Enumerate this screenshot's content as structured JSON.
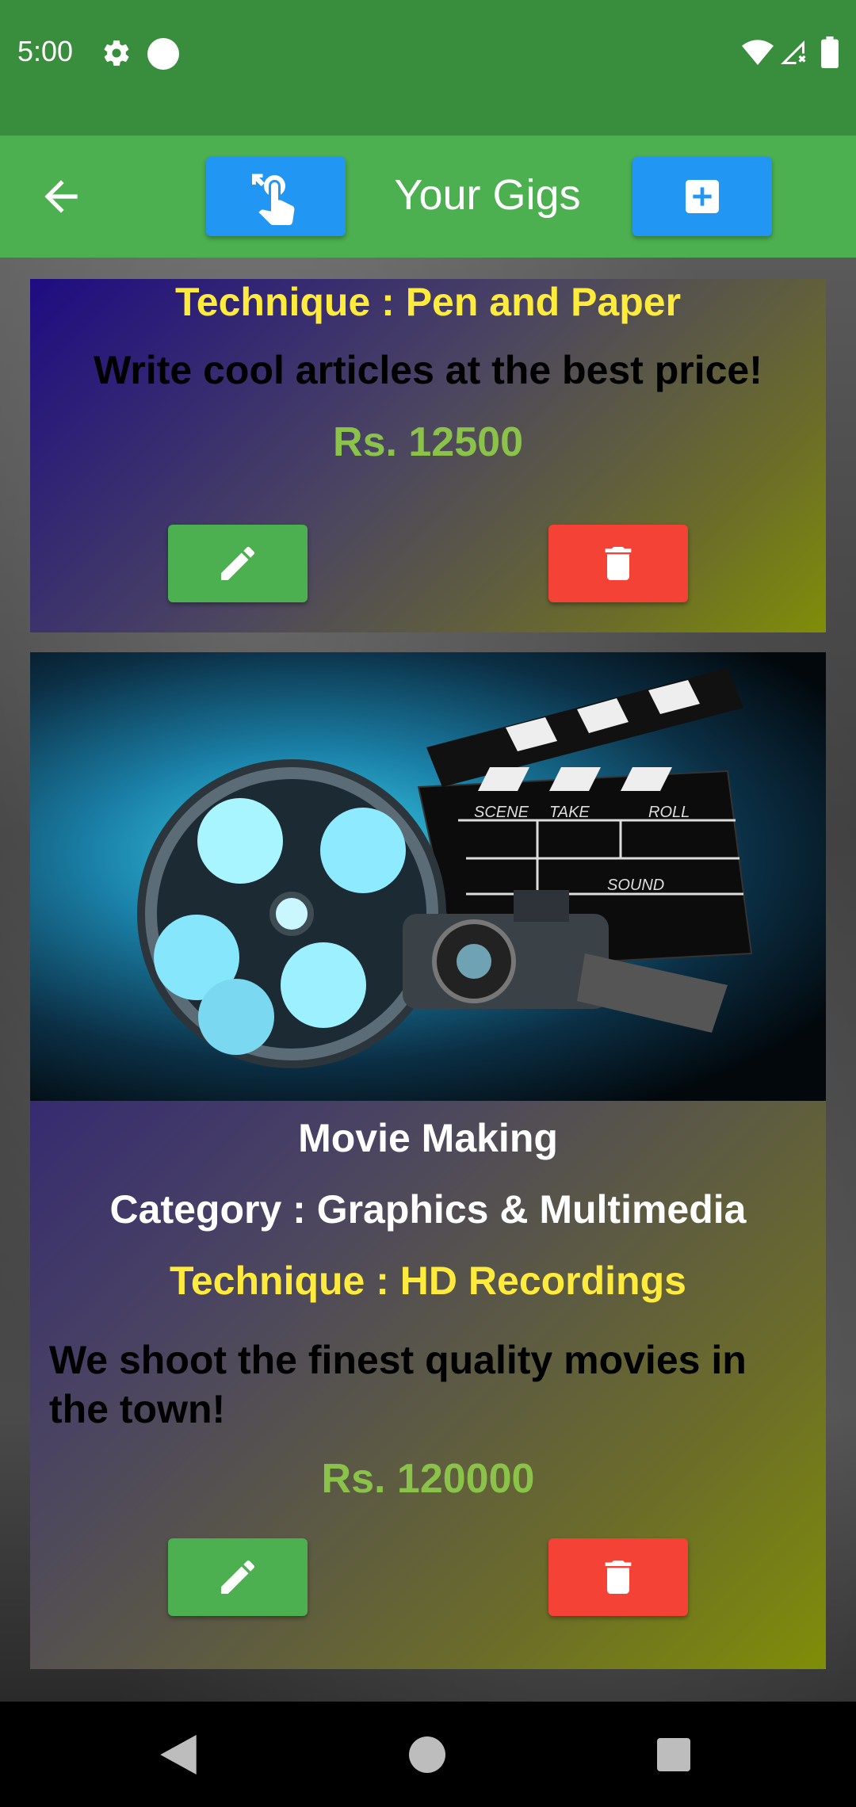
{
  "status_bar": {
    "time": "5:00"
  },
  "app_bar": {
    "title": "Your Gigs"
  },
  "gigs": [
    {
      "technique": "Technique : Pen and Paper",
      "description": "Write cool articles at the best price!",
      "price": "Rs.  12500"
    },
    {
      "title": "Movie Making",
      "category": "Category : Graphics & Multimedia",
      "technique": "Technique : HD Recordings",
      "description": "We shoot the finest quality movies in the town!",
      "price": "Rs.  120000",
      "image_text": {
        "scene": "SCENE",
        "take": "TAKE",
        "roll": "ROLL",
        "sound": "SOUND"
      }
    }
  ],
  "colors": {
    "status_bar": "#388e3c",
    "app_bar": "#4caf50",
    "blue_button": "#2196f3",
    "edit_button": "#4caf50",
    "delete_button": "#f44336",
    "technique_text": "#ffeb3b",
    "price_text": "#8bc34a"
  },
  "icons": [
    "settings-icon",
    "wifi-icon",
    "signal-icon",
    "battery-icon",
    "back-arrow-icon",
    "touch-gesture-icon",
    "add-box-icon",
    "pencil-icon",
    "trash-icon"
  ]
}
